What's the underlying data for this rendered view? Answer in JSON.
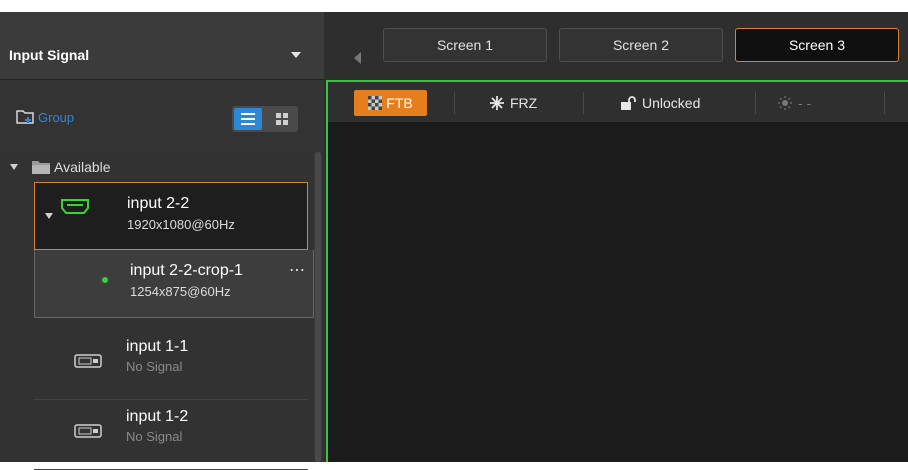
{
  "colors": {
    "accent_orange": "#e57e1d",
    "active_blue": "#2d87d7",
    "screen_border_green": "#39c539",
    "signal_green": "#3bd13b"
  },
  "input_panel": {
    "title": "Input Signal",
    "group_label": "Group",
    "available_label": "Available",
    "icons": [
      "dropdown-caret-icon",
      "add-folder-icon",
      "list-view-icon",
      "grid-view-icon",
      "folder-icon"
    ]
  },
  "inputs": [
    {
      "name": "input 2-2",
      "resolution": "1920x1080@60Hz",
      "icon": "hdmi-icon",
      "selected": true
    },
    {
      "name": "input 2-2-crop-1",
      "resolution": "1254x875@60Hz",
      "icon": "signal-dot-icon",
      "more": "⋯"
    },
    {
      "name": "input 1-1",
      "resolution": "No Signal",
      "icon": "dvi-icon"
    },
    {
      "name": "input 1-2",
      "resolution": "No Signal",
      "icon": "dvi-icon"
    }
  ],
  "screens": {
    "tabs": [
      "Screen 1",
      "Screen 2",
      "Screen 3"
    ],
    "active_tab": "Screen 3"
  },
  "toolbar": {
    "ftb": "FTB",
    "frz": "FRZ",
    "lock": "Unlocked",
    "brightness": "- -"
  }
}
